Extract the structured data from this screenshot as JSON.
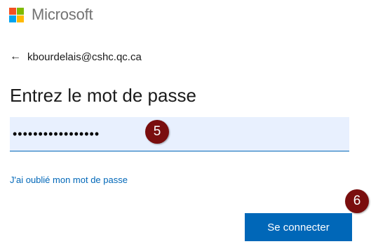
{
  "brand": {
    "name": "Microsoft",
    "colors": {
      "red": "#f25022",
      "green": "#7fba00",
      "blue": "#00a4ef",
      "yellow": "#ffb900"
    }
  },
  "identity": {
    "back_icon": "back-arrow-icon",
    "email": "kbourdelais@cshc.qc.ca"
  },
  "page": {
    "title": "Entrez le mot de passe"
  },
  "password": {
    "value": "•••••••••••••••••",
    "placeholder": ""
  },
  "annotations": {
    "step_5": "5",
    "step_6": "6",
    "color": "#7a0e0e"
  },
  "links": {
    "forgot_password": "J'ai oublié mon mot de passe"
  },
  "actions": {
    "sign_in_label": "Se connecter",
    "accent": "#0067b8"
  }
}
